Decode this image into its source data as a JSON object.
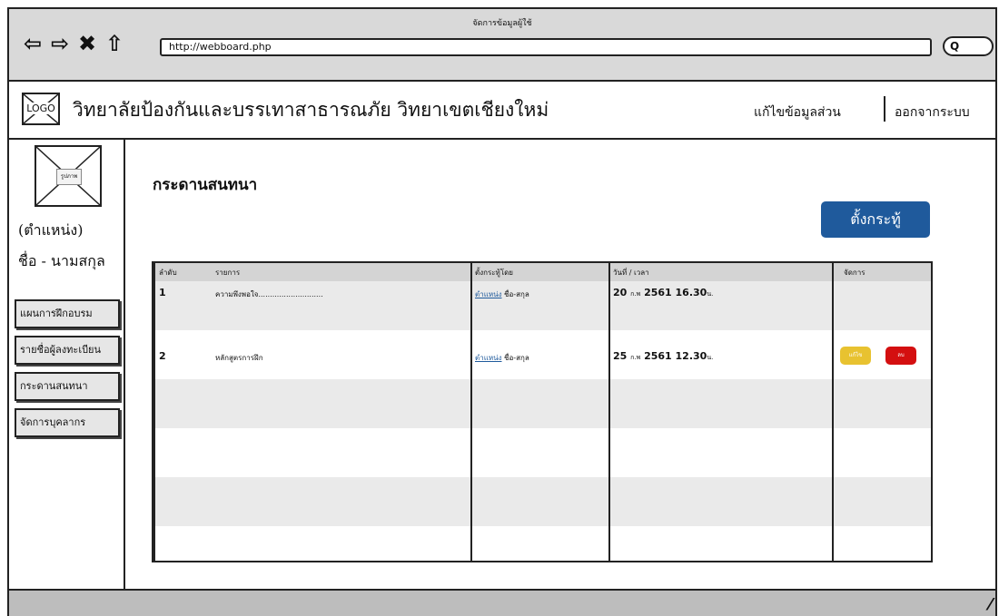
{
  "window": {
    "title": "จัดการข้อมูลผู้ใช้",
    "url": "http://webboard.php",
    "search_label": "Q"
  },
  "header": {
    "logo": "LOGO",
    "title": "วิทยาลัยป้องกันและบรรเทาสาธารณภัย วิทยาเขตเชียงใหม่",
    "links": [
      "แก้ไขข้อมูลส่วน",
      "ออกจากระบบ"
    ]
  },
  "sidebar": {
    "avatar_label": "รูปภาพ",
    "position": "(ตำแหน่ง)",
    "name": "ชื่อ - นามสกุล",
    "items": [
      "แผนการฝึกอบรม",
      "รายชื่อผู้ลงทะเบียน",
      "กระดานสนทนา",
      "จัดการบุคลากร"
    ]
  },
  "main": {
    "title": "กระดานสนทนา",
    "new_topic_button": "ตั้งกระทู้",
    "table": {
      "headers": [
        "ลำดับ",
        "รายการ",
        "ตั้งกระทู้โดย",
        "วันที่ / เวลา",
        "จัดการ"
      ],
      "rows": [
        {
          "no": "1",
          "item": "ความพึงพอใจ............................",
          "by_position": "ตำแหน่ง",
          "by_name": "ชื่อ-สกุล",
          "date_day": "20",
          "date_month": "ก.พ",
          "date_rest": "2561 16.30",
          "date_suffix": "น."
        },
        {
          "no": "2",
          "item": "หลักสูตรการฝึก",
          "by_position": "ตำแหน่ง",
          "by_name": "ชื่อ-สกุล",
          "date_day": "25",
          "date_month": "ก.พ",
          "date_rest": "2561 12.30",
          "date_suffix": "น.",
          "edit_label": "แก้ไข",
          "delete_label": "ลบ"
        }
      ]
    }
  },
  "colors": {
    "primary": "#1f5a9c",
    "edit": "#e8c230",
    "delete": "#d40f10"
  }
}
